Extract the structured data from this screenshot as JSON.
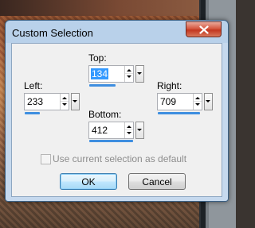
{
  "dialog": {
    "title": "Custom Selection",
    "close_icon": "close-icon"
  },
  "fields": {
    "top": {
      "label": "Top:",
      "value": "134"
    },
    "left": {
      "label": "Left:",
      "value": "233"
    },
    "right": {
      "label": "Right:",
      "value": "709"
    },
    "bottom": {
      "label": "Bottom:",
      "value": "412"
    }
  },
  "checkbox": {
    "label": "Use current selection as default",
    "checked": false,
    "enabled": false
  },
  "buttons": {
    "ok": "OK",
    "cancel": "Cancel"
  },
  "colors": {
    "titlebar": "#b9d1ea",
    "close_button": "#c3361f",
    "slider": "#3e8ee0",
    "selection": "#3399ff"
  }
}
